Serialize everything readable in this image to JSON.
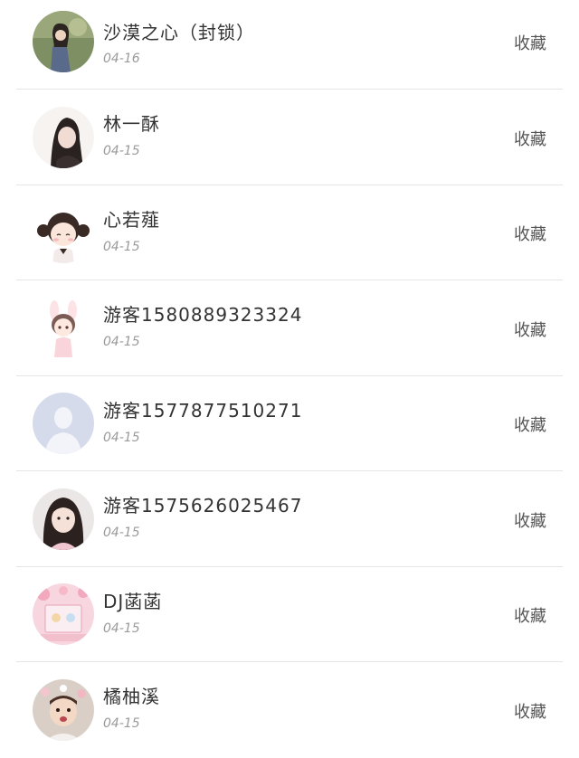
{
  "users": [
    {
      "name": "沙漠之心（封锁）",
      "date": "04-16",
      "action": "收藏",
      "avatar": "photo-woman-outdoor"
    },
    {
      "name": "林一酥",
      "date": "04-15",
      "action": "收藏",
      "avatar": "photo-woman-long-hair"
    },
    {
      "name": "心若薤",
      "date": "04-15",
      "action": "收藏",
      "avatar": "anime-girl-buns"
    },
    {
      "name": "游客1580889323324",
      "date": "04-15",
      "action": "收藏",
      "avatar": "anime-girl-bunny"
    },
    {
      "name": "游客1577877510271",
      "date": "04-15",
      "action": "收藏",
      "avatar": "default-person"
    },
    {
      "name": "游客1575626025467",
      "date": "04-15",
      "action": "收藏",
      "avatar": "photo-girl-selfie"
    },
    {
      "name": "DJ菡菡",
      "date": "04-15",
      "action": "收藏",
      "avatar": "pink-floral-illustration"
    },
    {
      "name": "橘柚溪",
      "date": "04-15",
      "action": "收藏",
      "avatar": "photo-child-flowers"
    }
  ]
}
